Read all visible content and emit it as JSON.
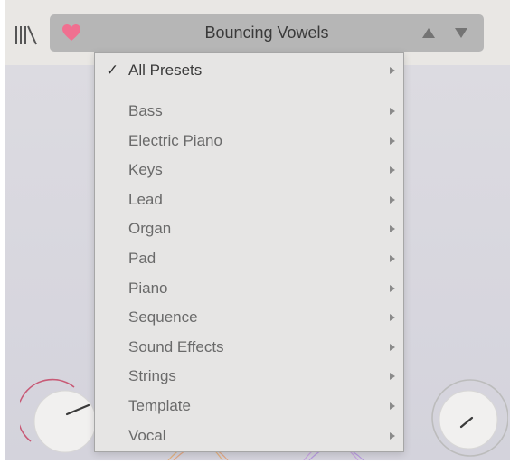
{
  "header": {
    "preset_name": "Bouncing Vowels",
    "library_icon": "library-icon",
    "favorite_icon": "heart-icon",
    "prev_icon": "triangle-up-icon",
    "next_icon": "triangle-down-icon"
  },
  "menu": {
    "all_presets": {
      "check": "✓",
      "label": "All Presets"
    },
    "categories": [
      "Bass",
      "Electric Piano",
      "Keys",
      "Lead",
      "Organ",
      "Pad",
      "Piano",
      "Sequence",
      "Sound Effects",
      "Strings",
      "Template",
      "Vocal"
    ]
  },
  "colors": {
    "heart": "#f07090",
    "menu_bg": "#e6e5e4",
    "preset_bar": "#b6b6b6"
  }
}
